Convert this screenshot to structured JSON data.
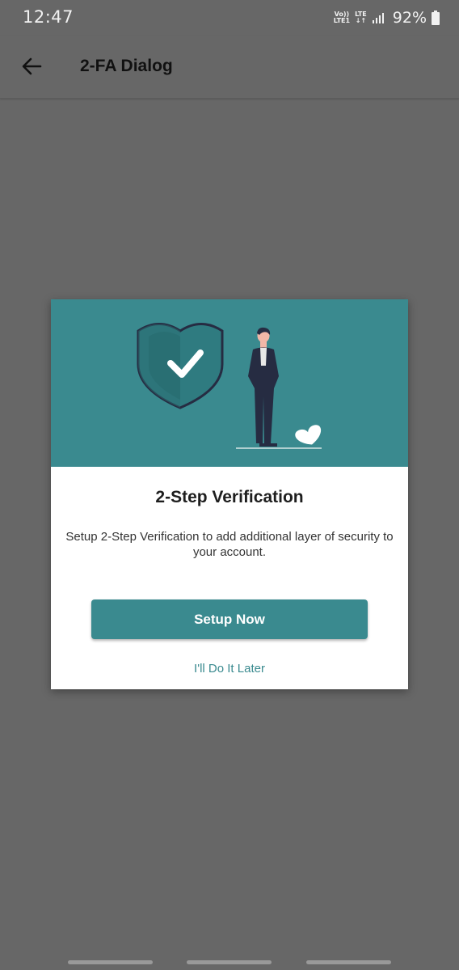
{
  "status_bar": {
    "time": "12:47",
    "network_top": "Vo))",
    "network_bottom": "LTE1",
    "lte_label": "LTE",
    "lte_arrows": "↓↑",
    "battery_percent": "92%"
  },
  "app_bar": {
    "title": "2-FA Dialog",
    "back_icon": "arrow-left-icon"
  },
  "dialog": {
    "title": "2-Step Verification",
    "description": "Setup 2-Step Verification to add additional layer of security to your account.",
    "primary_button": "Setup Now",
    "secondary_button": "I'll Do It Later",
    "hero_illustration": "shield-check-person-illustration"
  },
  "colors": {
    "accent": "#3a8a8f",
    "scrim": "#676767",
    "dialog_bg": "#ffffff"
  },
  "nav_bar": {
    "keys": [
      "recent-apps",
      "home",
      "back"
    ]
  }
}
